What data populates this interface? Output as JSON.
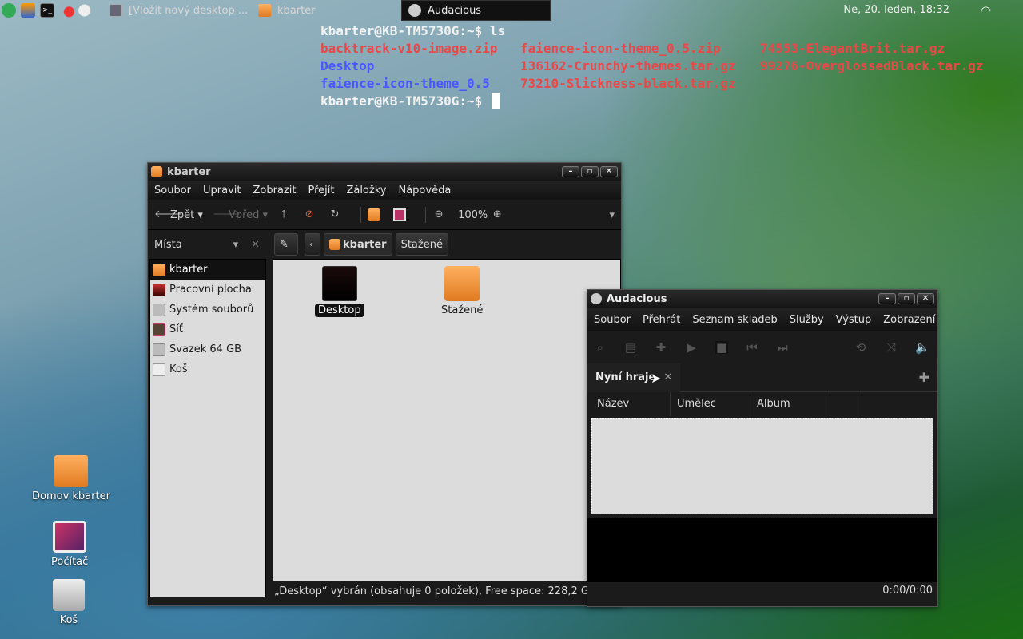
{
  "panel": {
    "tasks": [
      {
        "label": "[Vložit nový desktop ..."
      },
      {
        "label": "kbarter"
      },
      {
        "label": "Audacious"
      }
    ],
    "clock": "Ne, 20. leden, 18:32"
  },
  "terminal": {
    "line1": "kbarter@KB-TM5730G:~$ ls",
    "files_col1": [
      "backtrack-v10-image.zip",
      "Desktop",
      "faience-icon-theme_0.5"
    ],
    "files_col2": [
      "faience-icon-theme_0.5.zip",
      "136162-Crunchy-themes.tar.gz",
      "73210-Slickness-black.tar.gz"
    ],
    "files_col3": [
      "74553-ElegantBrit.tar.gz",
      "99276-OverglossedBlack.tar.gz"
    ],
    "prompt": "kbarter@KB-TM5730G:~$ "
  },
  "nautilus": {
    "title": "kbarter",
    "menu": [
      "Soubor",
      "Upravit",
      "Zobrazit",
      "Přejít",
      "Záložky",
      "Nápověda"
    ],
    "toolbar": {
      "back": "Zpět",
      "forward": "Vpřed",
      "zoom": "100%"
    },
    "places_label": "Místa",
    "crumbs": [
      "kbarter",
      "Stažené"
    ],
    "sidebar": [
      "kbarter",
      "Pracovní plocha",
      "Systém souborů",
      "Síť",
      "Svazek 64 GB",
      "Koš"
    ],
    "files": [
      "Desktop",
      "Stažené"
    ],
    "status": "„Desktop“ vybrán (obsahuje 0 položek), Free space: 228,2 GB"
  },
  "audacious": {
    "title": "Audacious",
    "menu": [
      "Soubor",
      "Přehrát",
      "Seznam skladeb",
      "Služby",
      "Výstup",
      "Zobrazení"
    ],
    "tab": "Nyní hraje",
    "columns": [
      "Název",
      "Umělec",
      "Album"
    ],
    "time": "0:00/0:00"
  },
  "desktop": [
    "Domov kbarter",
    "Počítač",
    "Koš"
  ]
}
